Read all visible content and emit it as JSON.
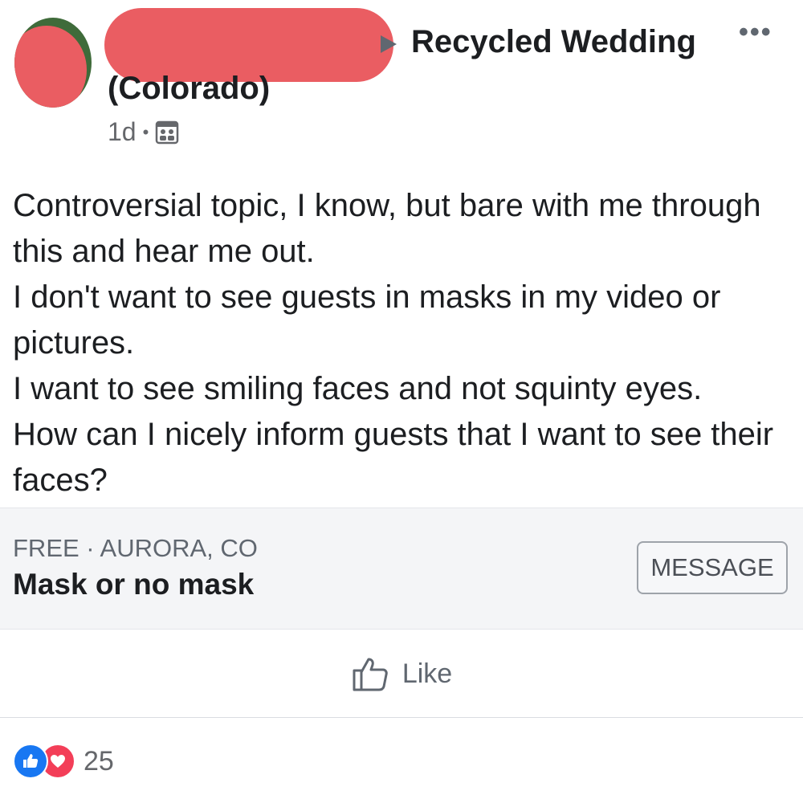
{
  "post": {
    "group_name_line1": "Recycled Wedding",
    "group_name_line2": "(Colorado)",
    "time": "1d",
    "visibility_icon": "group-icon",
    "more_icon": "more-options-icon",
    "body_lines": [
      "Controversial topic, I know, but bare with me through this and hear me out.",
      "I don't want to see guests in masks in my video or pictures.",
      "I want to see smiling faces and not squinty eyes.",
      "How can I nicely inform guests that I want to see their faces?"
    ]
  },
  "listing": {
    "subtitle": "FREE · AURORA, CO",
    "title": "Mask or no mask",
    "message_button": "MESSAGE"
  },
  "actions": {
    "like_label": "Like"
  },
  "reactions": {
    "count": "25",
    "types": [
      "like",
      "love"
    ]
  },
  "colors": {
    "redaction": "#ea5d62",
    "like_blue": "#1877f2",
    "love_red": "#f33e58"
  }
}
